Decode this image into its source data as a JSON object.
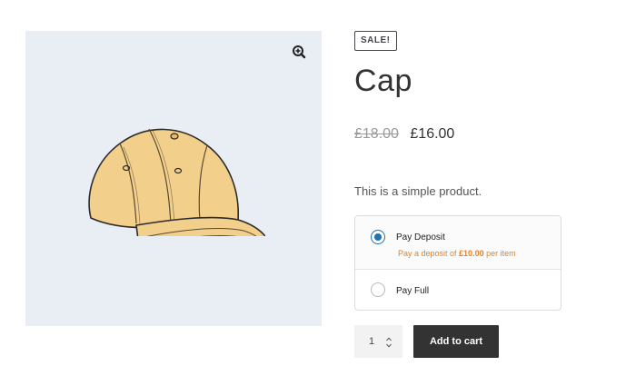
{
  "product": {
    "sale_badge": "SALE!",
    "title": "Cap",
    "regular_price": "£18.00",
    "sale_price": "£16.00",
    "short_description": "This is a simple product."
  },
  "deposit": {
    "options": [
      {
        "label": "Pay Deposit",
        "selected": true,
        "note_prefix": "Pay a deposit of ",
        "note_amount": "£10.00",
        "note_suffix": " per item"
      },
      {
        "label": "Pay Full",
        "selected": false
      }
    ]
  },
  "cart": {
    "quantity": "1",
    "add_to_cart_label": "Add to cart"
  },
  "icons": {
    "zoom": "zoom-in-icon",
    "spinner": "stepper-icon"
  },
  "colors": {
    "accent": "#2271b1",
    "deposit_note": "#e0832a",
    "button": "#333333",
    "image_bg": "#e9eef4"
  }
}
